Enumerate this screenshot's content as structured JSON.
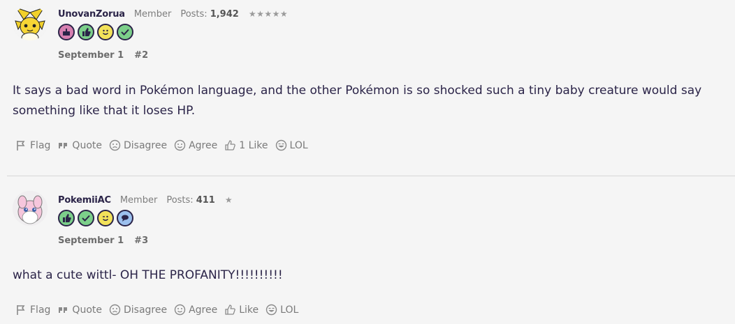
{
  "posts": [
    {
      "username": "UnovanZorua",
      "role": "Member",
      "posts_label": "Posts:",
      "posts_count": "1,942",
      "stars": "★★★★★",
      "badges": [
        "cake-badge-icon",
        "thumbs-up-badge-icon",
        "smile-badge-icon",
        "check-badge-icon"
      ],
      "date": "September 1",
      "number": "#2",
      "body": "It says a bad word in Pokémon language, and the other Pokémon is so shocked such a tiny baby creature would say something like that it loses HP.",
      "actions": {
        "flag": "Flag",
        "quote": "Quote",
        "disagree": "Disagree",
        "agree": "Agree",
        "like": "1 Like",
        "lol": "LOL"
      }
    },
    {
      "username": "PokemiiAC",
      "role": "Member",
      "posts_label": "Posts:",
      "posts_count": "411",
      "stars": "★",
      "badges": [
        "thumbs-up-badge-icon",
        "check-badge-icon",
        "wink-badge-icon",
        "speech-bubble-badge-icon"
      ],
      "date": "September 1",
      "number": "#3",
      "body": "what a cute wittl- OH THE PROFANITY!!!!!!!!!!",
      "actions": {
        "flag": "Flag",
        "quote": "Quote",
        "disagree": "Disagree",
        "agree": "Agree",
        "like": "Like",
        "lol": "LOL"
      }
    }
  ],
  "colors": {
    "text": "#2b2448",
    "muted": "#7a7a7a",
    "badge_pink": "#d67fb0",
    "badge_green": "#7ccf8a",
    "badge_yellow": "#f3e25a",
    "badge_blue": "#9cc0ee"
  }
}
